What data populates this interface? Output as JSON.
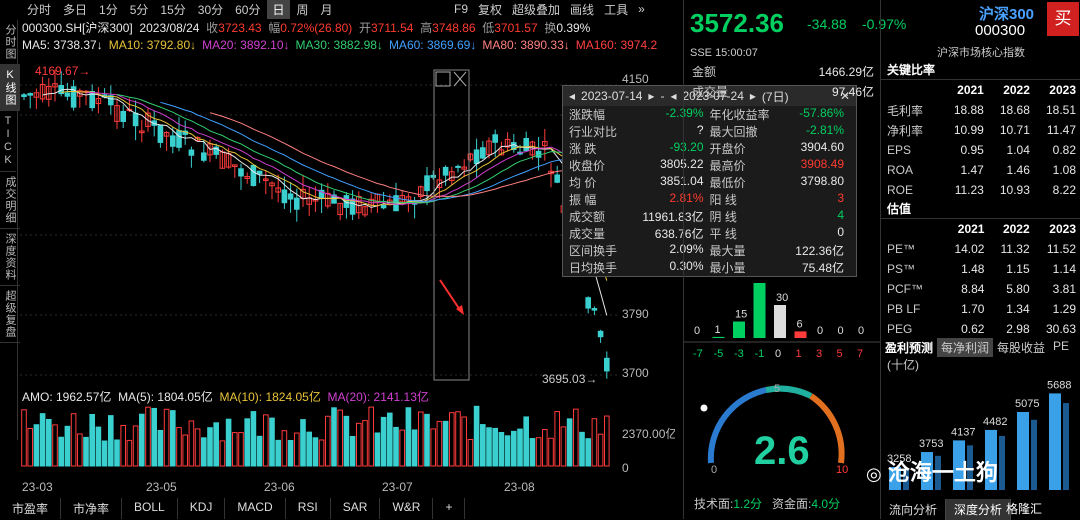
{
  "vtabs": [
    "分时图",
    "K线图",
    "TICK",
    "成交明细",
    "深度资料",
    "超级复盘"
  ],
  "periods": [
    "分时",
    "多日",
    "1分",
    "5分",
    "15分",
    "30分",
    "60分",
    "日",
    "周",
    "月"
  ],
  "topright": [
    "F9",
    "复权",
    "超级叠加",
    "画线",
    "工具"
  ],
  "info1": {
    "code": "000300.SH[沪深300]",
    "date": "2023/08/24",
    "close_l": "收",
    "close": "3723.43",
    "chg_l": "幅",
    "chg": "0.72%(26.80)",
    "open_l": "开",
    "open": "3711.54",
    "high_l": "高",
    "high": "3748.86",
    "low_l": "低",
    "low": "3701.57",
    "turn_l": "换",
    "turn": "0.39%"
  },
  "ma": [
    {
      "n": "MA5",
      "v": "3738.37↓",
      "c": "#e8e8e8"
    },
    {
      "n": "MA10",
      "v": "3792.80↓",
      "c": "#e8c33a"
    },
    {
      "n": "MA20",
      "v": "3892.10↓",
      "c": "#d040d0"
    },
    {
      "n": "MA30",
      "v": "3882.98↓",
      "c": "#30d070"
    },
    {
      "n": "MA60",
      "v": "3869.69↓",
      "c": "#40a0ff"
    },
    {
      "n": "MA80",
      "v": "3890.33↓",
      "c": "#ff8080"
    },
    {
      "n": "MA160",
      "v": "3974.2",
      "c": "#ff4040"
    }
  ],
  "price_axis": [
    "4150",
    "3790",
    "3700"
  ],
  "price_labels": {
    "hi": "4169.67",
    "lo": "3695.03"
  },
  "vol_info": {
    "amo": "AMO: 1962.57亿",
    "ma5": "MA(5): 1804.05亿",
    "ma10": "MA(10): 1824.05亿",
    "ma20": "MA(20): 2141.13亿",
    "axis": "2370.00亿",
    "axis0": "0"
  },
  "xaxis": [
    "23-03",
    "23-05",
    "23-06",
    "23-07",
    "23-08"
  ],
  "bottomtabs": [
    "市盈率",
    "市净率",
    "BOLL",
    "KDJ",
    "MACD",
    "RSI",
    "SAR",
    "W&R",
    "+"
  ],
  "popup": {
    "from": "2023-07-14",
    "to": "2023-07-24",
    "days": "(7日)",
    "rows": [
      [
        "涨跌幅",
        "-2.39%",
        "年化收益率",
        "-57.86%"
      ],
      [
        "行业对比",
        "",
        "最大回撤",
        "-2.81%"
      ],
      [
        "涨  跌",
        "-93.20",
        "开盘价",
        "3904.60"
      ],
      [
        "收盘价",
        "3805.22",
        "最高价",
        "3908.49"
      ],
      [
        "均  价",
        "3851.04",
        "最低价",
        "3798.80"
      ],
      [
        "振  幅",
        "2.81%",
        "阳  线",
        "3"
      ],
      [
        "成交额",
        "11961.83亿",
        "阴  线",
        "4"
      ],
      [
        "成交量",
        "638.76亿",
        "平  线",
        "0"
      ],
      [
        "区间换手",
        "2.09%",
        "最大量",
        "122.36亿"
      ],
      [
        "日均换手",
        "0.30%",
        "最小量",
        "75.48亿"
      ]
    ]
  },
  "quote": {
    "price": "3572.36",
    "chg": "-34.88",
    "pct": "-0.97%",
    "name": "沪深300",
    "code": "000300",
    "market": "SSE 15:00:07",
    "index_type": "沪深市场核心指数",
    "buy": "买",
    "rows": [
      [
        "金额",
        "1466.29亿"
      ],
      [
        "成交量",
        "97.46亿"
      ]
    ]
  },
  "dist": {
    "vals": [
      "0",
      "1",
      "15",
      "",
      "30",
      "6",
      "0",
      "0",
      "0"
    ],
    "labels": [
      "-7",
      "-5",
      "-3",
      "-1",
      "0",
      "1",
      "3",
      "5",
      "7"
    ]
  },
  "gauge": {
    "val": "2.6",
    "min": "0",
    "max": "10",
    "mid": "5"
  },
  "tech": {
    "a_l": "技术面:",
    "a": "1.2分",
    "b_l": "资金面:",
    "b": "4.0分"
  },
  "watermark": "沧海一土狗",
  "fin": {
    "title": "关键比率",
    "years": [
      "2021",
      "2022",
      "2023"
    ],
    "rows": [
      [
        "毛利率",
        "18.88",
        "18.68",
        "18.51"
      ],
      [
        "净利率",
        "10.99",
        "10.71",
        "11.47"
      ],
      [
        "EPS",
        "0.95",
        "1.04",
        "0.82"
      ],
      [
        "ROA",
        "1.47",
        "1.46",
        "1.08"
      ],
      [
        "ROE",
        "11.23",
        "10.93",
        "8.22"
      ]
    ]
  },
  "val": {
    "title": "估值",
    "years": [
      "2021",
      "2022",
      "2023"
    ],
    "rows": [
      [
        "PE™",
        "14.02",
        "11.32",
        "11.52"
      ],
      [
        "PS™",
        "1.48",
        "1.15",
        "1.14"
      ],
      [
        "PCF™",
        "8.84",
        "5.80",
        "3.81"
      ],
      [
        "PB LF",
        "1.70",
        "1.34",
        "1.29"
      ],
      [
        "PEG",
        "0.62",
        "2.98",
        "30.63"
      ]
    ]
  },
  "forecast": {
    "tabs": [
      "盈利预测",
      "每净利润",
      "每股收益",
      "PE"
    ],
    "unit": "(十亿)",
    "vals": [
      "3258",
      "3753",
      "4137",
      "4482",
      "5075",
      "5688"
    ]
  },
  "rbottom": [
    "流向分析",
    "深度分析"
  ],
  "logo": "格隆汇"
}
